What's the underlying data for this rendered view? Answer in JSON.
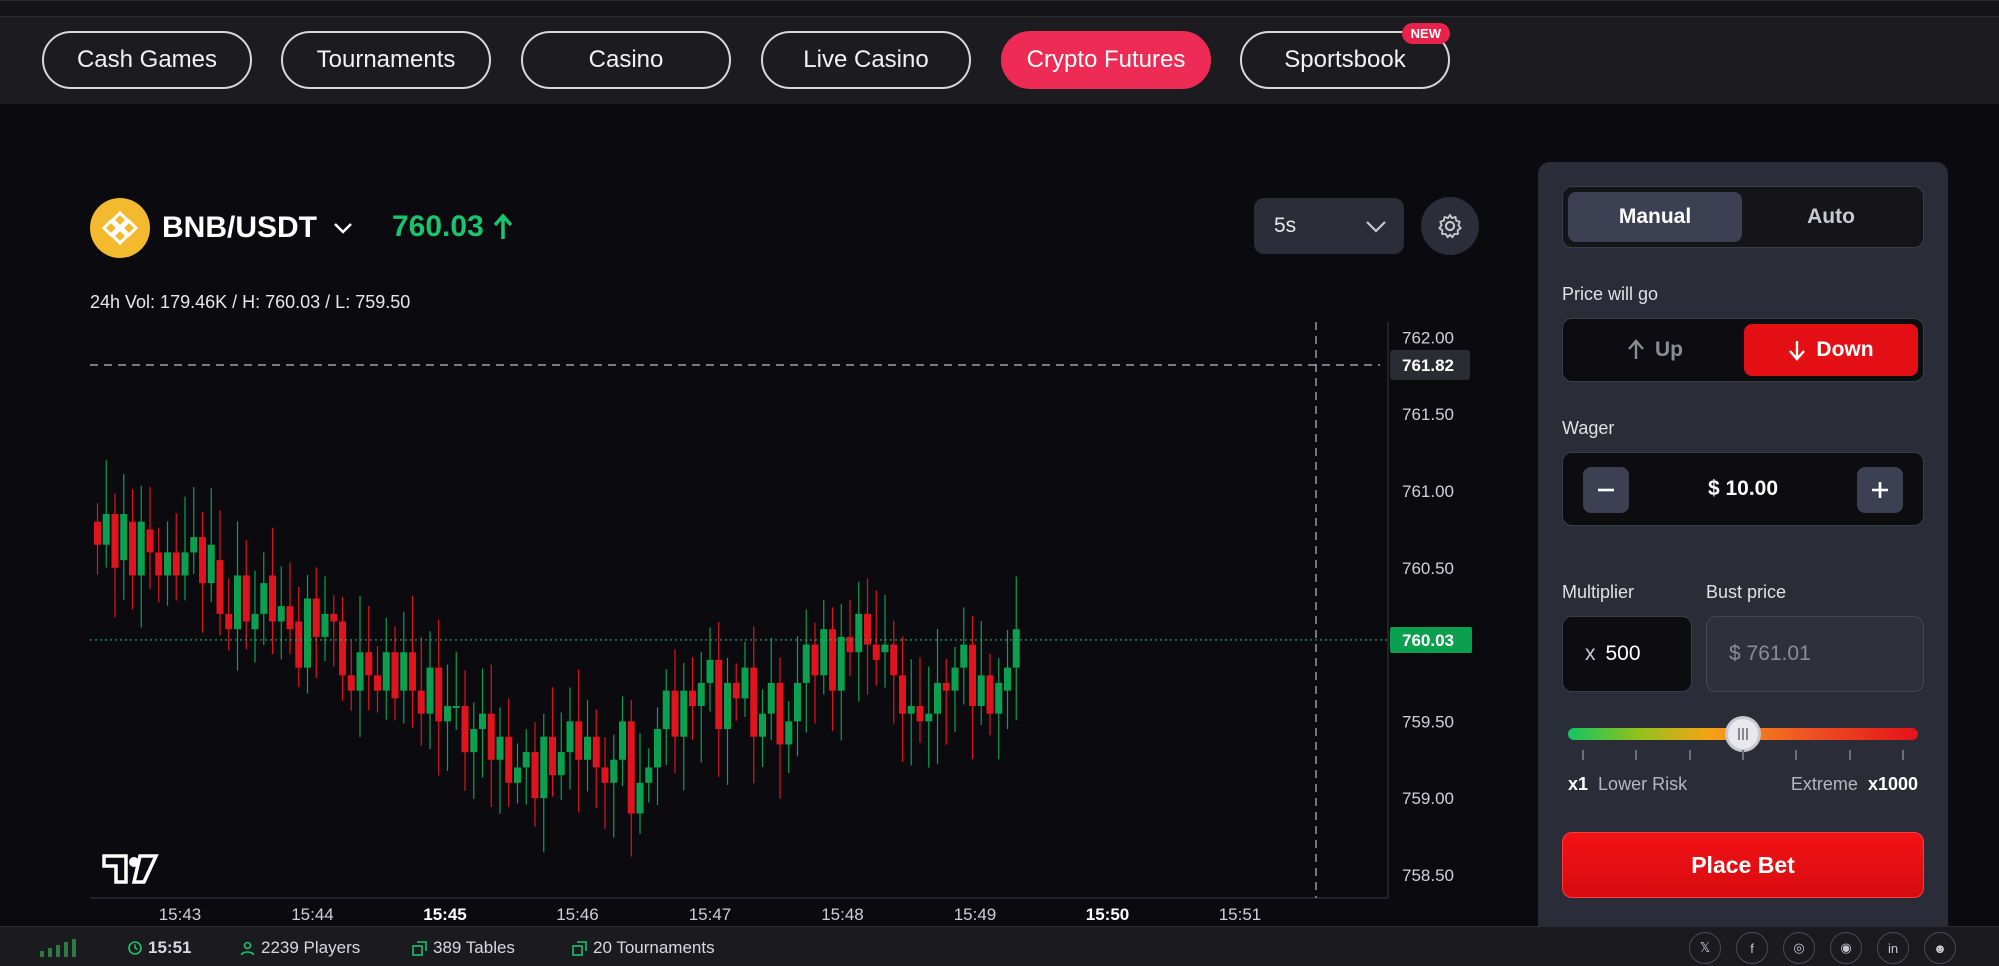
{
  "nav": {
    "items": [
      {
        "label": "Cash Games",
        "active": false
      },
      {
        "label": "Tournaments",
        "active": false
      },
      {
        "label": "Casino",
        "active": false
      },
      {
        "label": "Live Casino",
        "active": false
      },
      {
        "label": "Crypto Futures",
        "active": true
      },
      {
        "label": "Sportsbook",
        "active": false,
        "badge": "NEW"
      }
    ]
  },
  "market": {
    "pair": "BNB/USDT",
    "price": "760.03",
    "price_direction": "up",
    "stats": "24h Vol: 179.46K / H: 760.03 / L: 759.50",
    "interval": "5s"
  },
  "chart_data": {
    "type": "candlestick",
    "y_axis_labels": [
      "762.00",
      "761.50",
      "761.00",
      "760.50",
      "759.50",
      "759.00",
      "758.50"
    ],
    "ylim": [
      758.35,
      762.1
    ],
    "x_axis_labels": [
      {
        "label": "15:43",
        "bold": false
      },
      {
        "label": "15:44",
        "bold": false
      },
      {
        "label": "15:45",
        "bold": true
      },
      {
        "label": "15:46",
        "bold": false
      },
      {
        "label": "15:47",
        "bold": false
      },
      {
        "label": "15:48",
        "bold": false
      },
      {
        "label": "15:49",
        "bold": false
      },
      {
        "label": "15:50",
        "bold": true
      },
      {
        "label": "15:51",
        "bold": false
      }
    ],
    "crosshair_price": "761.82",
    "current_price": "760.03",
    "current_price_value": 760.03,
    "crosshair_value": 761.82,
    "colors": {
      "up": "#0aa04f",
      "down": "#e0141c",
      "grid": "#2a2a30"
    },
    "candles": [
      [
        760.8,
        760.65
      ],
      [
        760.65,
        760.85
      ],
      [
        760.85,
        760.5
      ],
      [
        760.55,
        760.85
      ],
      [
        760.8,
        760.45
      ],
      [
        760.45,
        760.8
      ],
      [
        760.75,
        760.6
      ],
      [
        760.6,
        760.45
      ],
      [
        760.45,
        760.6
      ],
      [
        760.6,
        760.45
      ],
      [
        760.45,
        760.6
      ],
      [
        760.6,
        760.7
      ],
      [
        760.7,
        760.4
      ],
      [
        760.4,
        760.65
      ],
      [
        760.55,
        760.2
      ],
      [
        760.2,
        760.1
      ],
      [
        760.1,
        760.45
      ],
      [
        760.45,
        760.15
      ],
      [
        760.1,
        760.2
      ],
      [
        760.2,
        760.4
      ],
      [
        760.45,
        760.15
      ],
      [
        760.15,
        760.25
      ],
      [
        760.25,
        760.1
      ],
      [
        760.15,
        759.85
      ],
      [
        759.85,
        760.3
      ],
      [
        760.3,
        760.05
      ],
      [
        760.05,
        760.2
      ],
      [
        760.2,
        760.15
      ],
      [
        760.15,
        759.8
      ],
      [
        759.8,
        759.7
      ],
      [
        759.7,
        759.95
      ],
      [
        759.95,
        759.8
      ],
      [
        759.8,
        759.7
      ],
      [
        759.7,
        759.95
      ],
      [
        759.95,
        759.65
      ],
      [
        759.7,
        759.95
      ],
      [
        759.95,
        759.7
      ],
      [
        759.7,
        759.55
      ],
      [
        759.55,
        759.85
      ],
      [
        759.85,
        759.5
      ],
      [
        759.5,
        759.6
      ],
      [
        759.6,
        759.6
      ],
      [
        759.6,
        759.3
      ],
      [
        759.3,
        759.45
      ],
      [
        759.45,
        759.55
      ],
      [
        759.55,
        759.25
      ],
      [
        759.25,
        759.4
      ],
      [
        759.4,
        759.1
      ],
      [
        759.1,
        759.2
      ],
      [
        759.2,
        759.3
      ],
      [
        759.3,
        759.0
      ],
      [
        759.0,
        759.4
      ],
      [
        759.4,
        759.15
      ],
      [
        759.15,
        759.3
      ],
      [
        759.3,
        759.5
      ],
      [
        759.5,
        759.25
      ],
      [
        759.25,
        759.4
      ],
      [
        759.4,
        759.2
      ],
      [
        759.2,
        759.1
      ],
      [
        759.1,
        759.25
      ],
      [
        759.25,
        759.5
      ],
      [
        759.5,
        758.9
      ],
      [
        758.9,
        759.1
      ],
      [
        759.1,
        759.2
      ],
      [
        759.2,
        759.45
      ],
      [
        759.45,
        759.7
      ],
      [
        759.7,
        759.4
      ],
      [
        759.4,
        759.7
      ],
      [
        759.7,
        759.6
      ],
      [
        759.6,
        759.75
      ],
      [
        759.75,
        759.9
      ],
      [
        759.9,
        759.45
      ],
      [
        759.45,
        759.75
      ],
      [
        759.75,
        759.65
      ],
      [
        759.65,
        759.85
      ],
      [
        759.85,
        759.4
      ],
      [
        759.4,
        759.55
      ],
      [
        759.55,
        759.75
      ],
      [
        759.75,
        759.35
      ],
      [
        759.35,
        759.5
      ],
      [
        759.5,
        759.75
      ],
      [
        759.75,
        760.0
      ],
      [
        760.0,
        759.8
      ],
      [
        759.8,
        760.1
      ],
      [
        760.1,
        759.7
      ],
      [
        759.7,
        760.05
      ],
      [
        760.05,
        759.95
      ],
      [
        759.95,
        760.2
      ],
      [
        760.2,
        760.0
      ],
      [
        760.0,
        759.9
      ],
      [
        759.95,
        760.0
      ],
      [
        760.0,
        759.8
      ],
      [
        759.8,
        759.55
      ],
      [
        759.55,
        759.6
      ],
      [
        759.6,
        759.5
      ],
      [
        759.5,
        759.55
      ],
      [
        759.55,
        759.75
      ],
      [
        759.75,
        759.7
      ],
      [
        759.7,
        759.85
      ],
      [
        759.85,
        760.0
      ],
      [
        760.0,
        759.6
      ],
      [
        759.6,
        759.8
      ],
      [
        759.8,
        759.55
      ],
      [
        759.55,
        759.75
      ],
      [
        759.7,
        759.85
      ],
      [
        759.85,
        760.1
      ]
    ]
  },
  "bet_panel": {
    "tabs": [
      {
        "label": "Manual",
        "active": true
      },
      {
        "label": "Auto",
        "active": false
      }
    ],
    "direction_label": "Price will go",
    "up_label": "Up",
    "down_label": "Down",
    "selected_direction": "down",
    "wager_label": "Wager",
    "wager_value": "$ 10.00",
    "multiplier_label": "Multiplier",
    "multiplier_prefix": "x",
    "multiplier_value": "500",
    "bust_label": "Bust price",
    "bust_value": "$ 761.01",
    "slider_position": 0.5,
    "min_label": "x1",
    "min_text": "Lower Risk",
    "max_text": "Extreme",
    "max_label": "x1000",
    "place_bet_label": "Place Bet"
  },
  "footer": {
    "time": "15:51",
    "players": "2239 Players",
    "tables": "389 Tables",
    "tournaments": "20 Tournaments",
    "socials": [
      "x-icon",
      "facebook-icon",
      "instagram-icon",
      "discord-icon",
      "linkedin-icon",
      "reddit-icon"
    ]
  }
}
